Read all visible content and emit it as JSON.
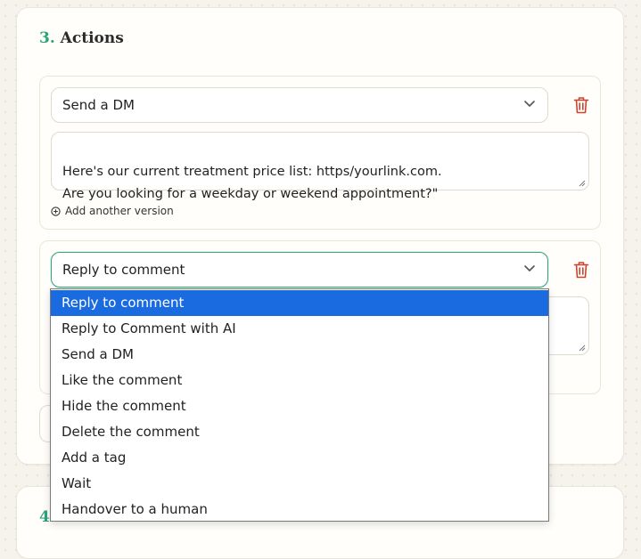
{
  "colors": {
    "accent": "#2aa37a",
    "danger": "#c9452f",
    "selected": "#1a6bdf"
  },
  "section": {
    "number": "3.",
    "title": "Actions"
  },
  "action1": {
    "type": "Send a DM",
    "message": "Here's our current treatment price list: https/yourlink.com.\nAre you looking for a weekday or weekend appointment?\"",
    "add_version": "Add another version"
  },
  "action2": {
    "type": "Reply to comment"
  },
  "dropdown": {
    "options": [
      "Reply to comment",
      "Reply to Comment with AI",
      "Send a DM",
      "Like the comment",
      "Hide the comment",
      "Delete the comment",
      "Add a tag",
      "Wait",
      "Handover to a human"
    ],
    "selected": "Reply to comment"
  },
  "next_section": {
    "number": "4.",
    "title": ""
  },
  "icons": [
    "chevron-down-icon",
    "trash-icon",
    "plus-circle-icon"
  ]
}
